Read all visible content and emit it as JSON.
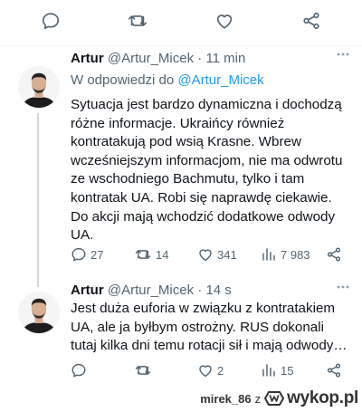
{
  "toolbar": {
    "icons": [
      "reply-icon",
      "retweet-icon",
      "like-icon",
      "share-icon"
    ]
  },
  "tweet1": {
    "name": "Artur",
    "handle": "@Artur_Micek",
    "dot": "·",
    "time": "11 min",
    "reply_prefix": "W odpowiedzi do",
    "reply_handle": "@Artur_Micek",
    "lines": [
      "Sytuacja jest bardzo dynamiczna i dochodzą",
      "różne informacje. Ukraińcy również",
      "kontratakują pod wsią Krasne. Wbrew",
      "wcześniejszym informacjom, nie ma odwrotu",
      "ze wschodniego Bachmutu, tylko i tam",
      "kontratak UA.  Robi się naprawdę ciekawie.",
      "Do akcji mają wchodzić dodatkowe odwody",
      "UA."
    ],
    "replies": "27",
    "retweets": "14",
    "likes": "341",
    "views": "7 983"
  },
  "tweet2": {
    "name": "Artur",
    "handle": "@Artur_Micek",
    "dot": "·",
    "time": "14 s",
    "lines": [
      "Jest duża euforia w związku z kontratakiem",
      "UA, ale ja byłbym ostrożny. RUS dokonali",
      "tutaj kilka dni temu rotacji sił i mają odwody…"
    ],
    "replies": "",
    "retweets": "",
    "likes": "2",
    "views": "15"
  },
  "footer": {
    "user": "mirek_86",
    "z": "z",
    "site": "wykop.pl"
  },
  "colors": {
    "text": "#0f1419",
    "secondary": "#536471",
    "link": "#1d9bf0",
    "divider": "#eff3f4"
  }
}
